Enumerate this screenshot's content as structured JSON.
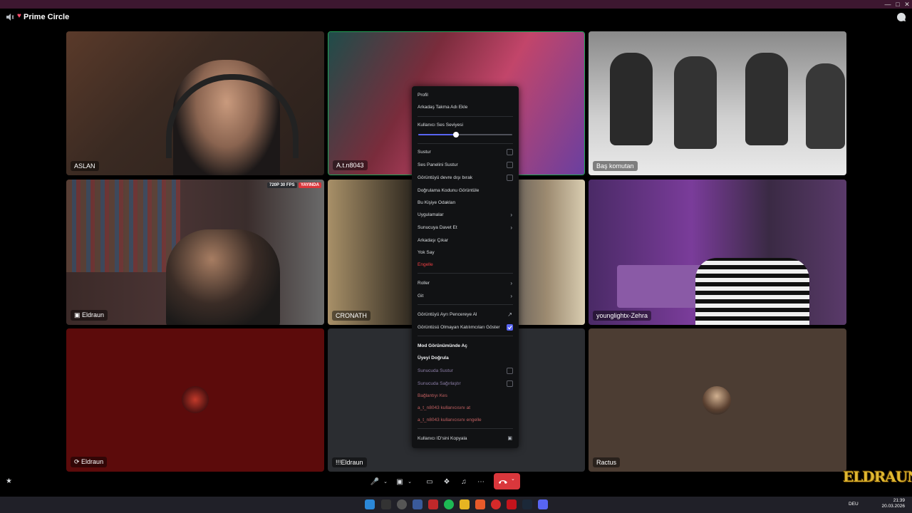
{
  "header": {
    "title": "Prime Circle"
  },
  "tiles": [
    {
      "name": "ASLAN"
    },
    {
      "name": "A.t.n8043"
    },
    {
      "name": "Baş komutan"
    },
    {
      "name": "Eldraun",
      "badges": [
        "720P 30 FPS",
        "YAYINDA"
      ]
    },
    {
      "name": "CRONATH"
    },
    {
      "name": "younglightx-Zehra"
    },
    {
      "name": "Eldraun"
    },
    {
      "name": "!!!Eldraun"
    },
    {
      "name": "Ractus"
    }
  ],
  "menu": {
    "profile": "Profil",
    "add_nickname": "Arkadaş Takma Adı Ekle",
    "volume_label": "Kullanıcı Ses Seviyesi",
    "volume_level": 0.4,
    "mute": "Sustur",
    "mute_soundboard": "Ses Panelini Sustur",
    "disable_video": "Görüntüyü devre dışı bırak",
    "view_verification": "Doğrulama Kodunu Görüntüle",
    "focus_person": "Bu Kişiye Odaklan",
    "apps": "Uygulamalar",
    "invite_server": "Sunucuya Davet Et",
    "remove_friend": "Arkadaşı Çıkar",
    "ignore": "Yok Say",
    "block": "Engelle",
    "roles": "Roller",
    "move": "Git",
    "popout_video": "Görüntüyü Ayrı Pencereye Al",
    "show_non_video": "Görüntüsü Olmayan Katılımcıları Göster",
    "mod_view": "Mod Görünümünde Aç",
    "verify_member": "Üyeyi Doğrula",
    "server_mute": "Sunucuda Sustur",
    "server_deafen": "Sunucuda Sağırlaştır",
    "disconnect": "Bağlantıyı Kes",
    "kick": "a_t_n8043 kullanıcısını at",
    "ban": "a_t_n8043 kullanıcısını engelle",
    "copy_id": "Kullanıcı ID'sini Kopyala"
  },
  "overlay_logo": "ELDRAUN",
  "taskbar": {
    "lang": "DEU",
    "time": "21:39",
    "date": "20.03.2026"
  }
}
